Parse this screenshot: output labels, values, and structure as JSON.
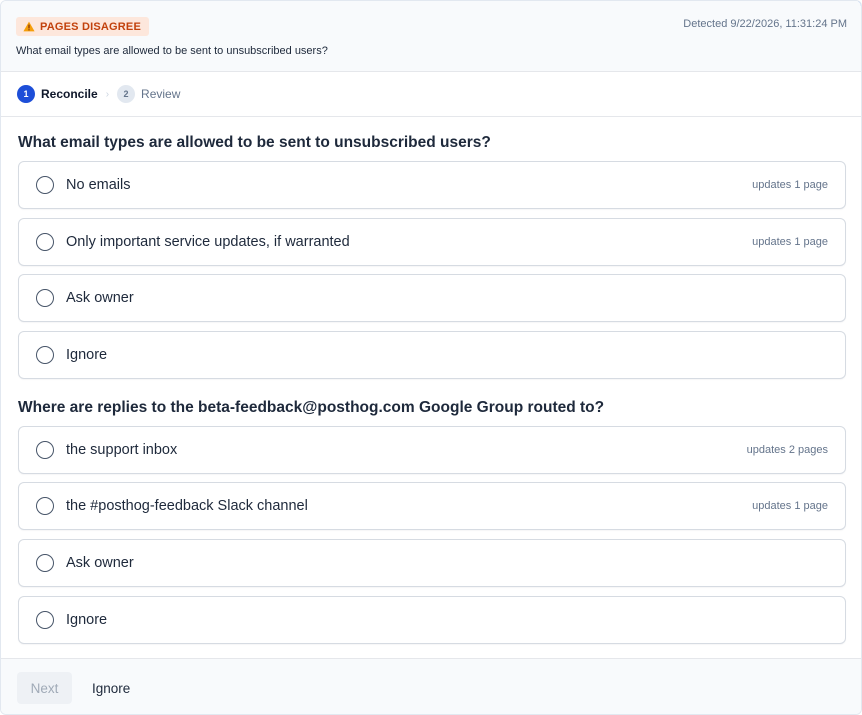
{
  "header": {
    "badge_label": "PAGES DISAGREE",
    "badge_icon": "warning-icon",
    "timestamp": "Detected 9/22/2026, 11:31:24 PM",
    "question": "What email types are allowed to be sent to unsubscribed users?",
    "colors": {
      "badge_bg": "#fde7dc",
      "badge_text": "#c2410c",
      "accent": "#3b82f6"
    }
  },
  "stepper": {
    "steps": [
      {
        "number": "1",
        "label": "Reconcile",
        "active": true
      },
      {
        "number": "2",
        "label": "Review",
        "active": false
      }
    ],
    "separator": "›",
    "active_color": "#1d4ed8"
  },
  "questions": [
    {
      "title": "What email types are allowed to be sent to unsubscribed users?",
      "options": [
        {
          "label": "No emails",
          "meta": "updates 1 page"
        },
        {
          "label": "Only important service updates, if warranted",
          "meta": "updates 1 page"
        },
        {
          "label": "Ask owner",
          "meta": ""
        },
        {
          "label": "Ignore",
          "meta": ""
        }
      ]
    },
    {
      "title": "Where are replies to the beta-feedback@posthog.com Google Group routed to?",
      "options": [
        {
          "label": "the support inbox",
          "meta": "updates 2 pages"
        },
        {
          "label": "the #posthog-feedback Slack channel",
          "meta": "updates 1 page"
        },
        {
          "label": "Ask owner",
          "meta": ""
        },
        {
          "label": "Ignore",
          "meta": ""
        }
      ]
    }
  ],
  "footer": {
    "next_label": "Next",
    "next_disabled": true,
    "ignore_label": "Ignore"
  }
}
